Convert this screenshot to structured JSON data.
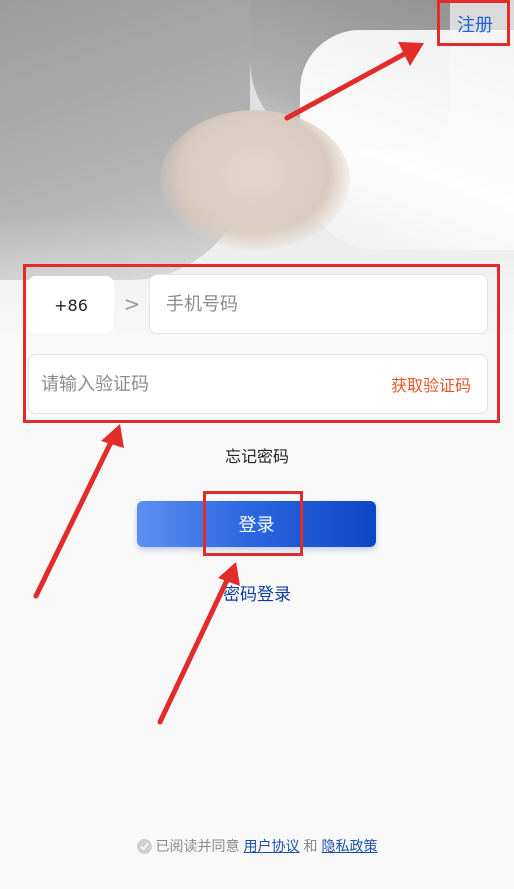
{
  "header": {
    "register_label": "注册"
  },
  "login_form": {
    "country_code": "+86",
    "chevron": ">",
    "phone_placeholder": "手机号码",
    "code_placeholder": "请输入验证码",
    "get_code_label": "获取验证码"
  },
  "links": {
    "forgot_password": "忘记密码",
    "password_login": "密码登录"
  },
  "login_button_label": "登录",
  "agreement": {
    "prefix": "已阅读并同意",
    "user_agreement": "用户协议",
    "and": "和",
    "privacy_policy": "隐私政策"
  },
  "icons": {
    "hero": "handshake-photo",
    "agree": "check-circle-icon",
    "chevron": "chevron-right-icon"
  },
  "colors": {
    "accent_blue": "#1e63d6",
    "button_gradient_start": "#5d8ff0",
    "button_gradient_end": "#0d47c6",
    "get_code_orange": "#e2572b",
    "annotation_red": "#e22b2b",
    "page_background": "#f9f9f9"
  }
}
